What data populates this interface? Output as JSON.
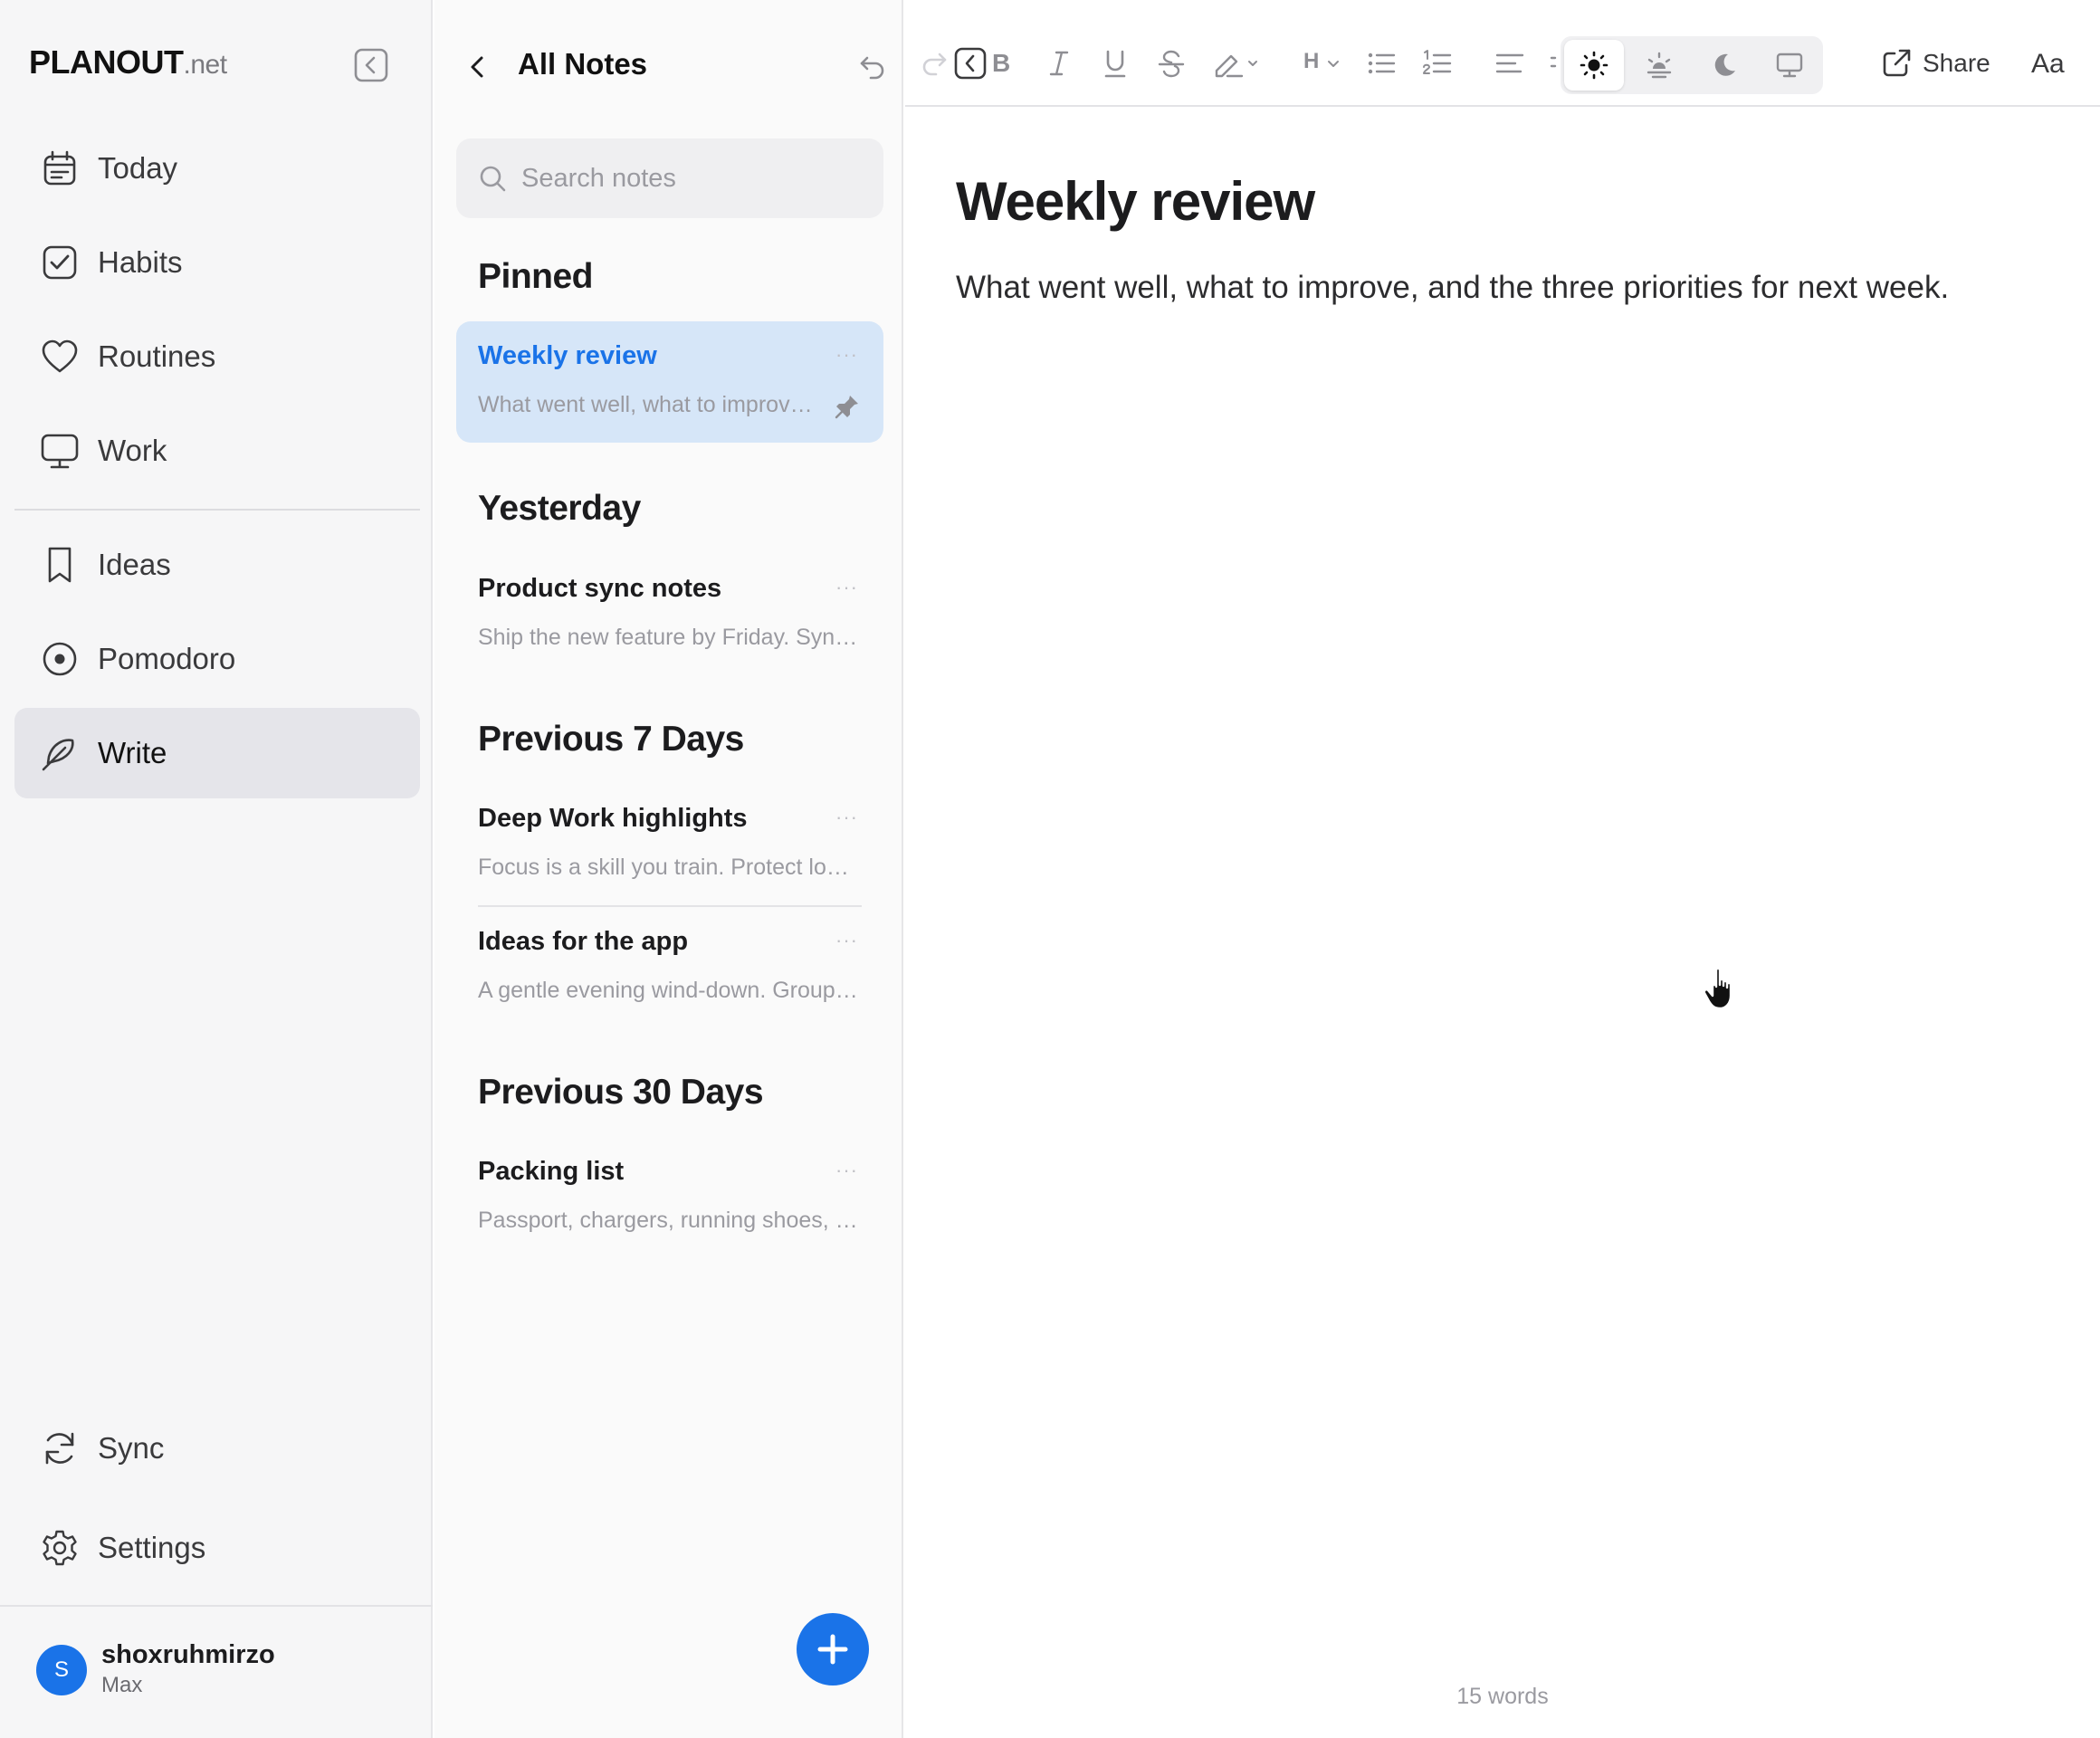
{
  "app": {
    "logo_bold": "PLANOUT",
    "logo_suffix": ".net"
  },
  "sidebar": {
    "items": [
      {
        "label": "Today",
        "icon": "calendar-icon"
      },
      {
        "label": "Habits",
        "icon": "checkbox-icon"
      },
      {
        "label": "Routines",
        "icon": "heart-icon"
      },
      {
        "label": "Work",
        "icon": "monitor-icon"
      },
      {
        "label": "Ideas",
        "icon": "bookmark-icon"
      },
      {
        "label": "Pomodoro",
        "icon": "target-icon"
      },
      {
        "label": "Write",
        "icon": "feather-icon",
        "active": true
      }
    ],
    "bottom": [
      {
        "label": "Sync",
        "icon": "sync-icon"
      },
      {
        "label": "Settings",
        "icon": "gear-icon"
      }
    ],
    "user": {
      "initial": "S",
      "name": "shoxruhmirzo",
      "plan": "Max"
    }
  },
  "notes_panel": {
    "title": "All Notes",
    "search_placeholder": "Search notes",
    "sections": [
      {
        "heading": "Pinned",
        "notes": [
          {
            "title": "Weekly review",
            "preview": "What went well, what to improve, and the three priorities for next week.",
            "selected": true,
            "pinned": true
          }
        ]
      },
      {
        "heading": "Yesterday",
        "notes": [
          {
            "title": "Product sync notes",
            "preview": "Ship the new feature by Friday. Sync with design"
          }
        ]
      },
      {
        "heading": "Previous 7 Days",
        "notes": [
          {
            "title": "Deep Work highlights",
            "preview": "Focus is a skill you train. Protect long blocks"
          },
          {
            "title": "Ideas for the app",
            "preview": "A gentle evening wind-down. Group routines"
          }
        ]
      },
      {
        "heading": "Previous 30 Days",
        "notes": [
          {
            "title": "Packing list",
            "preview": "Passport, chargers, running shoes, notebook"
          }
        ]
      }
    ],
    "more_glyph": "···"
  },
  "editor": {
    "toolbar": {
      "bold": "B",
      "heading": "H",
      "share_label": "Share",
      "font_label": "Aa",
      "active_theme": "light"
    },
    "document": {
      "title": "Weekly review",
      "body": "What went well, what to improve, and the three priorities for next week."
    },
    "word_count": "15 words"
  },
  "colors": {
    "accent": "#1a73e8",
    "selected_note_bg": "#d6e6f8",
    "sidebar_bg": "#f6f6f7",
    "active_nav_bg": "#e5e5ea"
  }
}
